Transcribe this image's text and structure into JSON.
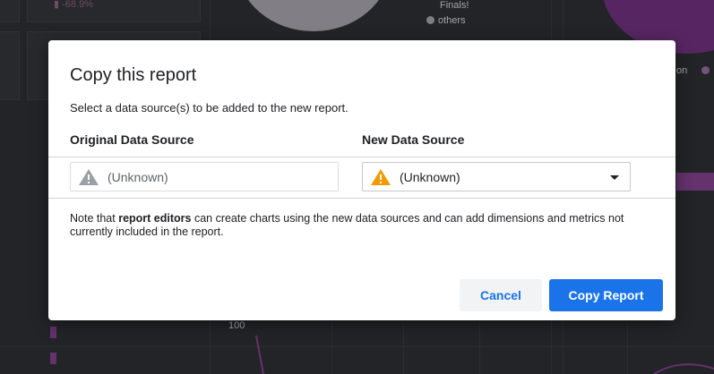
{
  "background": {
    "kpi_delta": "▮ -68.9%",
    "legend_top": "Finals!",
    "legend_others": "others",
    "legend_right": "on",
    "axis_tick": "100"
  },
  "dialog": {
    "title": "Copy this report",
    "subtitle": "Select a data source(s) to be added to the new report.",
    "original_header": "Original Data Source",
    "new_header": "New Data Source",
    "original_value": "(Unknown)",
    "new_value": "(Unknown)",
    "note_prefix": "Note that ",
    "note_bold": "report editors",
    "note_suffix": " can create charts using the new data sources and can add dimensions and metrics not currently included in the report.",
    "cancel_label": "Cancel",
    "copy_label": "Copy Report"
  },
  "colors": {
    "primary": "#1a73e8",
    "warning_orange": "#f29900",
    "warning_gray": "#9aa0a6"
  }
}
